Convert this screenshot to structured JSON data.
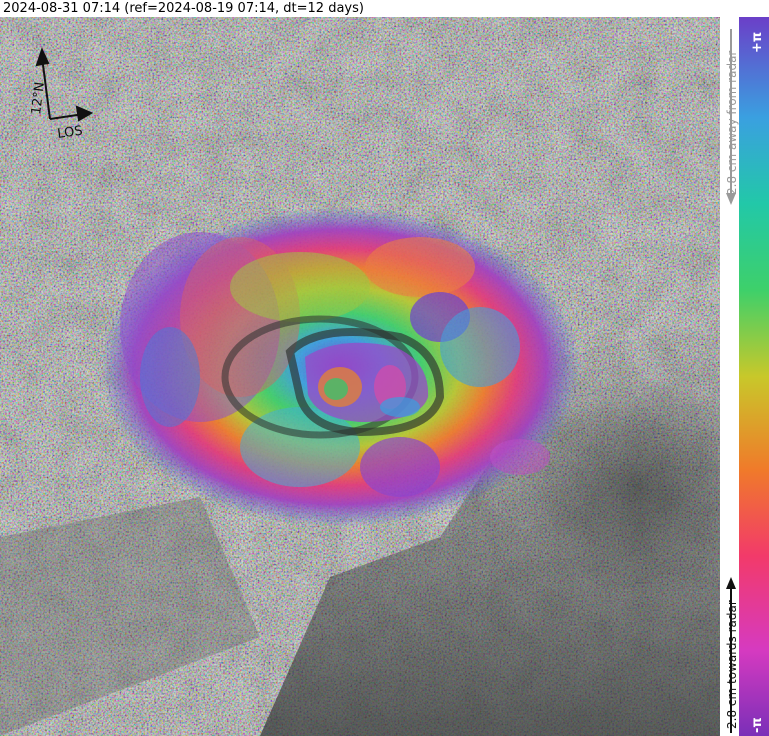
{
  "title": "2024-08-31 07:14 (ref=2024-08-19 07:14, dt=12 days)",
  "compass": {
    "north_label": "12°N",
    "los_label": "LOS"
  },
  "colorbar": {
    "top_label": "+π",
    "bottom_label": "-π",
    "away_label": "2.8 cm away from radar",
    "towards_label": "2.8 cm towards radar",
    "colors": [
      "#7a2fb8",
      "#d63ac0",
      "#f23a6a",
      "#f07a2a",
      "#c8c82a",
      "#3ed06a",
      "#22c8a8",
      "#3aa0e0",
      "#4d5fd8",
      "#6b3fc8"
    ]
  }
}
